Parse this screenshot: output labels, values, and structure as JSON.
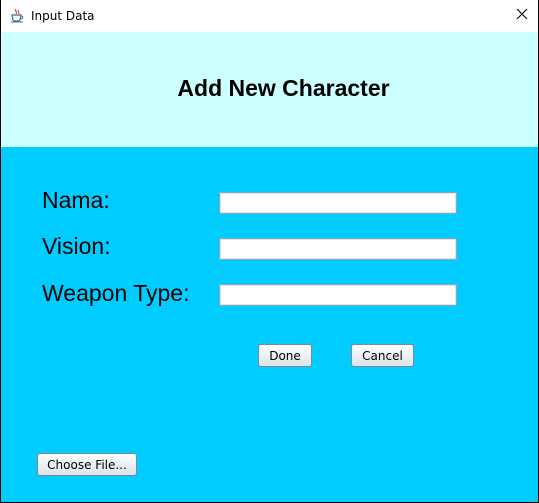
{
  "window": {
    "title": "Input Data",
    "icon": "java-cup-icon",
    "close_glyph": "✕"
  },
  "header": {
    "title": "Add New Character"
  },
  "form": {
    "fields": [
      {
        "label": "Nama:",
        "value": "",
        "placeholder": ""
      },
      {
        "label": "Vision:",
        "value": "",
        "placeholder": ""
      },
      {
        "label": "Weapon Type:",
        "value": "",
        "placeholder": ""
      }
    ],
    "done_label": "Done",
    "cancel_label": "Cancel",
    "choose_file_label": "Choose File..."
  },
  "colors": {
    "header_bg": "#ccffff",
    "form_bg": "#00ccff"
  }
}
